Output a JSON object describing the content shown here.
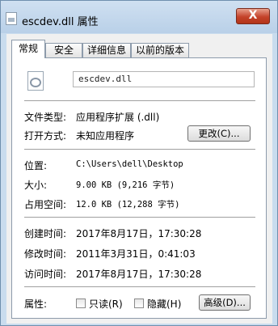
{
  "window": {
    "title": "escdev.dll 属性",
    "close_label": "X"
  },
  "tabs": [
    {
      "label": "常规"
    },
    {
      "label": "安全"
    },
    {
      "label": "详细信息"
    },
    {
      "label": "以前的版本"
    }
  ],
  "file": {
    "name": "escdev.dll"
  },
  "rows": {
    "file_type": {
      "label": "文件类型:",
      "value": "应用程序扩展 (.dll)"
    },
    "opens_with": {
      "label": "打开方式:",
      "value": "未知应用程序",
      "button": "更改(C)..."
    },
    "location": {
      "label": "位置:",
      "value": "C:\\Users\\dell\\Desktop"
    },
    "size": {
      "label": "大小:",
      "value": "9.00 KB (9,216 字节)"
    },
    "size_on_disk": {
      "label": "占用空间:",
      "value": "12.0 KB (12,288 字节)"
    },
    "created": {
      "label": "创建时间:",
      "value": "2017年8月17日，17:30:28"
    },
    "modified": {
      "label": "修改时间:",
      "value": "2011年3月31日，0:41:03"
    },
    "accessed": {
      "label": "访问时间:",
      "value": "2017年8月17日，17:30:28"
    },
    "attributes": {
      "label": "属性:",
      "readonly": {
        "label": "只读(R)",
        "checked": false
      },
      "hidden": {
        "label": "隐藏(H)",
        "checked": false
      },
      "advanced_button": "高级(D)..."
    }
  },
  "colors": {
    "frame": "#c9dcee",
    "close_button": "#c4422a",
    "panel": "#ffffff"
  }
}
